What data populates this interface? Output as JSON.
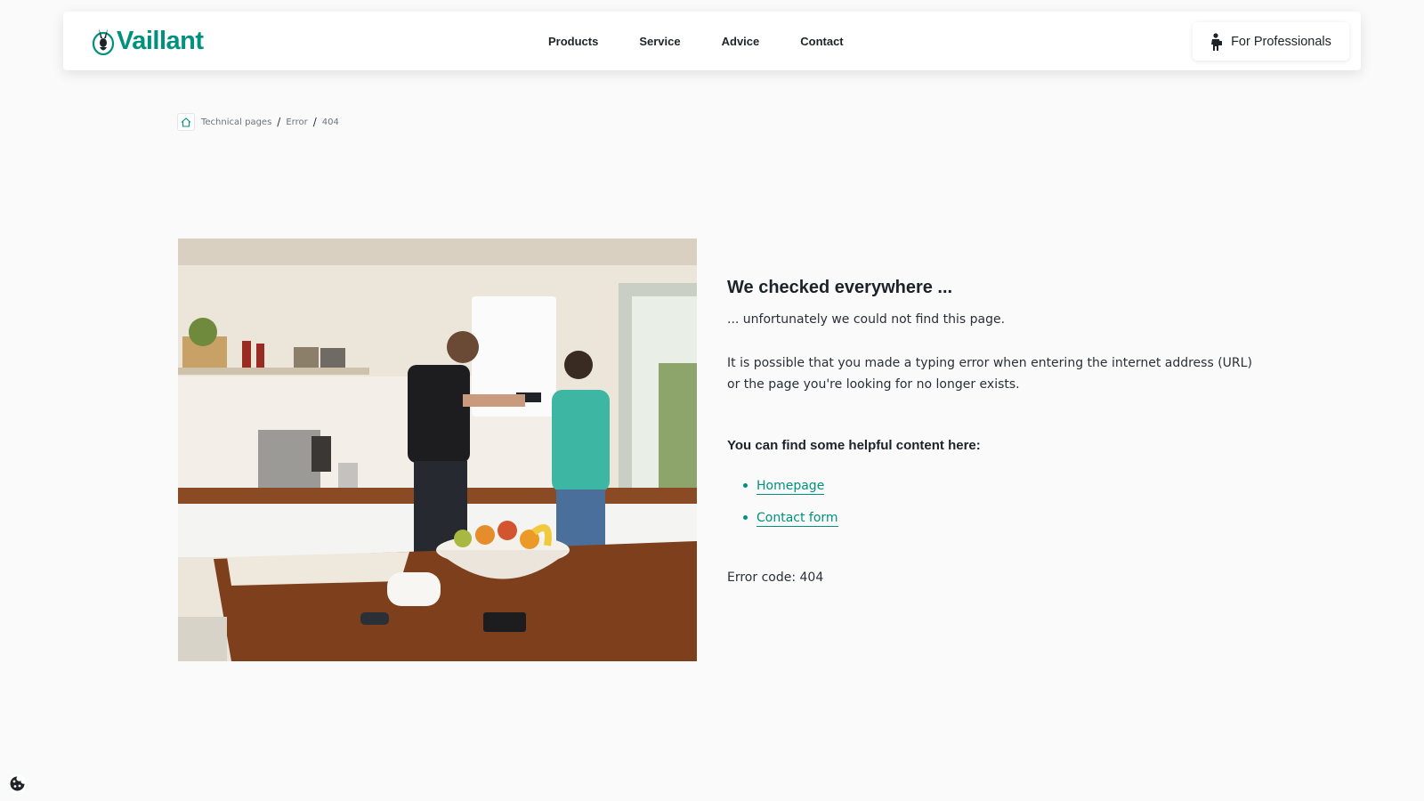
{
  "header": {
    "logo_text": "Vaillant",
    "nav": [
      {
        "label": "Products"
      },
      {
        "label": "Service"
      },
      {
        "label": "Advice"
      },
      {
        "label": "Contact"
      }
    ],
    "professionals_label": "For Professionals",
    "professionals_icon": "installer-icon"
  },
  "breadcrumb": {
    "home_icon": "home-icon",
    "items": [
      "Technical pages",
      "Error",
      "404"
    ],
    "separator": "/"
  },
  "main": {
    "image_alt": "kitchen with boiler",
    "title": "We checked everywhere ...",
    "subtitle": "... unfortunately we could not find this page.",
    "description": "It is possible that you made a typing error when entering the internet address (URL) or the page you're looking for no longer exists.",
    "helpful_heading": "You can find some helpful content here:",
    "links": [
      {
        "label": "Homepage"
      },
      {
        "label": "Contact form"
      }
    ],
    "error_code": "Error code: 404"
  },
  "cookie_icon": "cookie-icon",
  "colors": {
    "brand": "#00917e",
    "text": "#2b2f36",
    "background": "#fafafa"
  }
}
